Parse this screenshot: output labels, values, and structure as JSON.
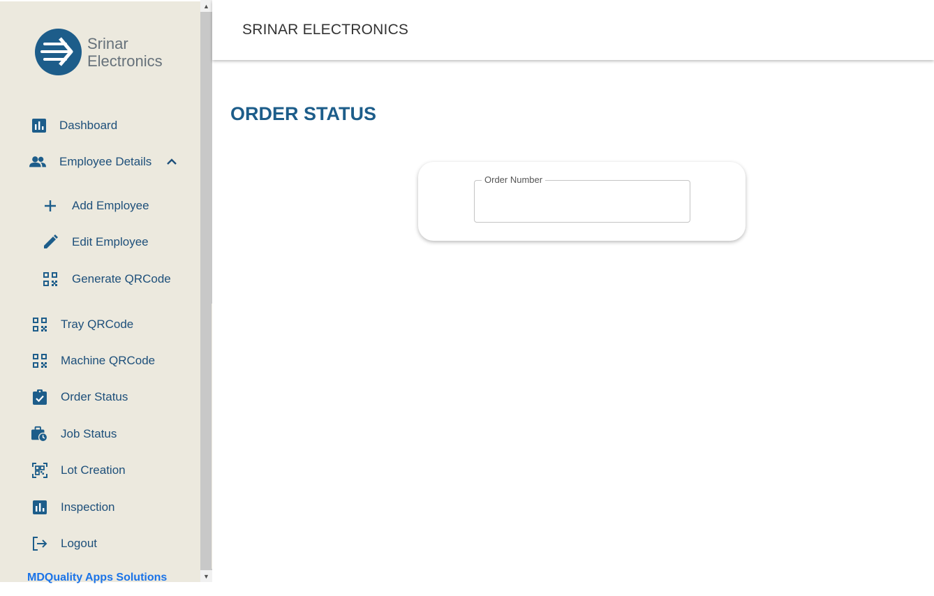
{
  "brand": {
    "logo_line1": "Srinar",
    "logo_line2": "Electronics",
    "footer": "MDQuality Apps Solutions",
    "colors": {
      "primary": "#1d5d8a",
      "sidebar_bg": "#ece9de",
      "footer_link": "#1a73e8"
    }
  },
  "sidebar": {
    "items": [
      {
        "label": "Dashboard",
        "icon": "bar-chart-icon"
      },
      {
        "label": "Employee Details",
        "icon": "people-icon",
        "expanded": true
      },
      {
        "label": "Add Employee",
        "icon": "plus-icon"
      },
      {
        "label": "Edit Employee",
        "icon": "pencil-icon"
      },
      {
        "label": "Generate QRCode",
        "icon": "qr-code-icon"
      },
      {
        "label": "Tray QRCode",
        "icon": "qr-code-icon"
      },
      {
        "label": "Machine QRCode",
        "icon": "qr-code-icon"
      },
      {
        "label": "Order Status",
        "icon": "clipboard-check-icon"
      },
      {
        "label": "Job Status",
        "icon": "briefcase-clock-icon"
      },
      {
        "label": "Lot Creation",
        "icon": "qr-scan-icon"
      },
      {
        "label": "Inspection",
        "icon": "bar-chart-icon"
      },
      {
        "label": "Logout",
        "icon": "logout-icon"
      }
    ]
  },
  "header": {
    "title": "SRINAR ELECTRONICS"
  },
  "main": {
    "page_title": "ORDER STATUS",
    "order_field": {
      "label": "Order Number",
      "value": ""
    }
  }
}
